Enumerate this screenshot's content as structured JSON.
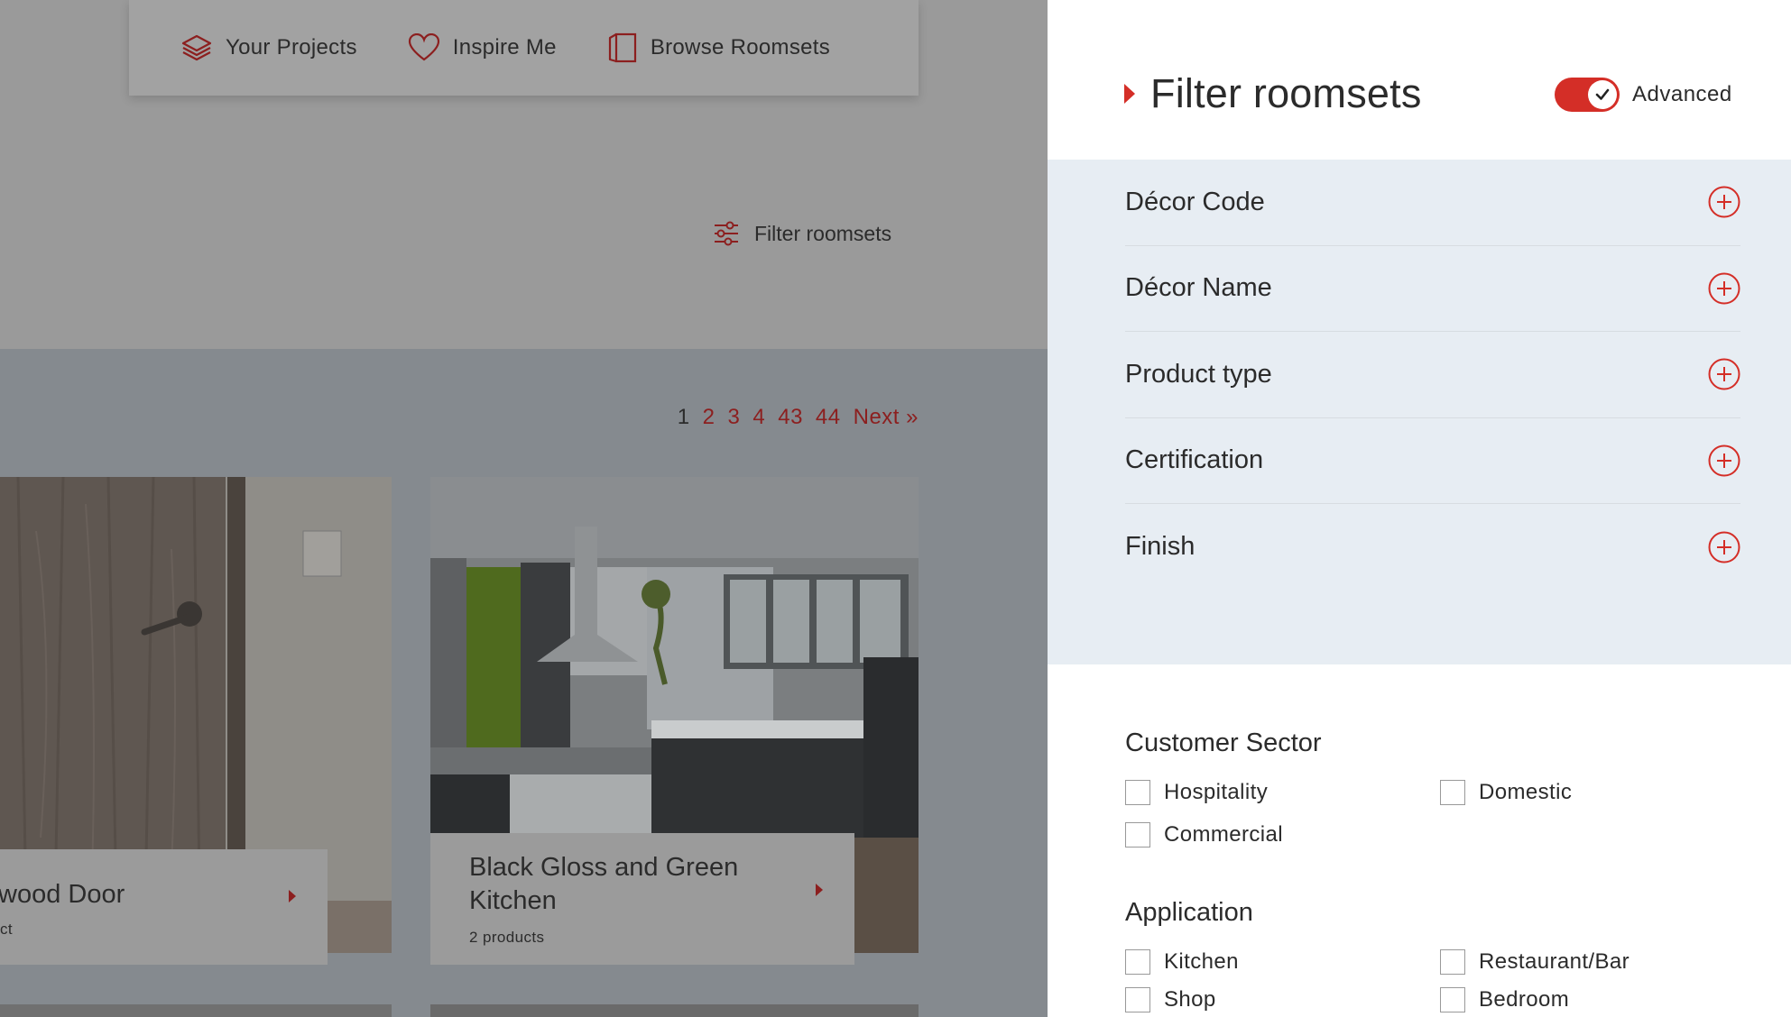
{
  "nav": {
    "items": [
      {
        "label": "Your Projects",
        "icon": "layers-icon"
      },
      {
        "label": "Inspire Me",
        "icon": "heart-icon"
      },
      {
        "label": "Browse Roomsets",
        "icon": "roomset-icon"
      }
    ]
  },
  "filter_link": {
    "label": "Filter roomsets",
    "icon": "sliders-icon"
  },
  "pagination": {
    "current": "1",
    "pages": [
      "2",
      "3",
      "4",
      "43",
      "44"
    ],
    "next": "Next »"
  },
  "cards": [
    {
      "title": "wood Door",
      "subtitle": "ct"
    },
    {
      "title": "Black Gloss and Green Kitchen",
      "subtitle": "2 products"
    }
  ],
  "panel": {
    "title": "Filter roomsets",
    "toggle_label": "Advanced",
    "toggle_on": true,
    "accent": "#d42e27",
    "accordion": [
      "Décor Code",
      "Décor Name",
      "Product type",
      "Certification",
      "Finish"
    ],
    "customer_sector": {
      "title": "Customer Sector",
      "options": [
        "Hospitality",
        "Domestic",
        "Commercial"
      ]
    },
    "application": {
      "title": "Application",
      "options": [
        "Kitchen",
        "Restaurant/Bar",
        "Shop",
        "Bedroom"
      ]
    }
  }
}
